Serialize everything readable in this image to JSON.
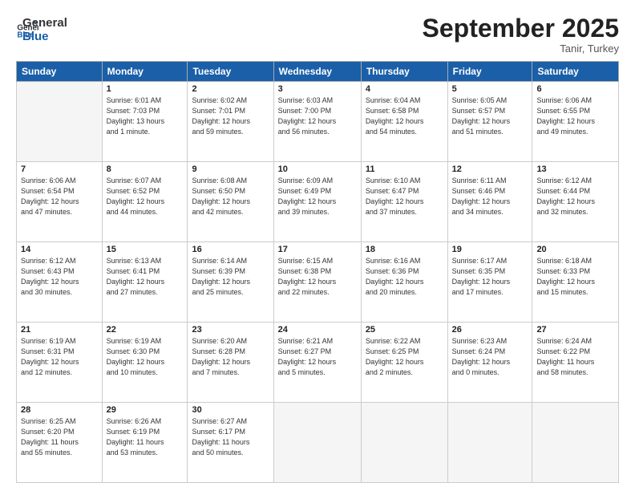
{
  "logo": {
    "line1": "General",
    "line2": "Blue"
  },
  "title": "September 2025",
  "location": "Tanir, Turkey",
  "days_header": [
    "Sunday",
    "Monday",
    "Tuesday",
    "Wednesday",
    "Thursday",
    "Friday",
    "Saturday"
  ],
  "weeks": [
    [
      {
        "day": "",
        "detail": ""
      },
      {
        "day": "1",
        "detail": "Sunrise: 6:01 AM\nSunset: 7:03 PM\nDaylight: 13 hours\nand 1 minute."
      },
      {
        "day": "2",
        "detail": "Sunrise: 6:02 AM\nSunset: 7:01 PM\nDaylight: 12 hours\nand 59 minutes."
      },
      {
        "day": "3",
        "detail": "Sunrise: 6:03 AM\nSunset: 7:00 PM\nDaylight: 12 hours\nand 56 minutes."
      },
      {
        "day": "4",
        "detail": "Sunrise: 6:04 AM\nSunset: 6:58 PM\nDaylight: 12 hours\nand 54 minutes."
      },
      {
        "day": "5",
        "detail": "Sunrise: 6:05 AM\nSunset: 6:57 PM\nDaylight: 12 hours\nand 51 minutes."
      },
      {
        "day": "6",
        "detail": "Sunrise: 6:06 AM\nSunset: 6:55 PM\nDaylight: 12 hours\nand 49 minutes."
      }
    ],
    [
      {
        "day": "7",
        "detail": "Sunrise: 6:06 AM\nSunset: 6:54 PM\nDaylight: 12 hours\nand 47 minutes."
      },
      {
        "day": "8",
        "detail": "Sunrise: 6:07 AM\nSunset: 6:52 PM\nDaylight: 12 hours\nand 44 minutes."
      },
      {
        "day": "9",
        "detail": "Sunrise: 6:08 AM\nSunset: 6:50 PM\nDaylight: 12 hours\nand 42 minutes."
      },
      {
        "day": "10",
        "detail": "Sunrise: 6:09 AM\nSunset: 6:49 PM\nDaylight: 12 hours\nand 39 minutes."
      },
      {
        "day": "11",
        "detail": "Sunrise: 6:10 AM\nSunset: 6:47 PM\nDaylight: 12 hours\nand 37 minutes."
      },
      {
        "day": "12",
        "detail": "Sunrise: 6:11 AM\nSunset: 6:46 PM\nDaylight: 12 hours\nand 34 minutes."
      },
      {
        "day": "13",
        "detail": "Sunrise: 6:12 AM\nSunset: 6:44 PM\nDaylight: 12 hours\nand 32 minutes."
      }
    ],
    [
      {
        "day": "14",
        "detail": "Sunrise: 6:12 AM\nSunset: 6:43 PM\nDaylight: 12 hours\nand 30 minutes."
      },
      {
        "day": "15",
        "detail": "Sunrise: 6:13 AM\nSunset: 6:41 PM\nDaylight: 12 hours\nand 27 minutes."
      },
      {
        "day": "16",
        "detail": "Sunrise: 6:14 AM\nSunset: 6:39 PM\nDaylight: 12 hours\nand 25 minutes."
      },
      {
        "day": "17",
        "detail": "Sunrise: 6:15 AM\nSunset: 6:38 PM\nDaylight: 12 hours\nand 22 minutes."
      },
      {
        "day": "18",
        "detail": "Sunrise: 6:16 AM\nSunset: 6:36 PM\nDaylight: 12 hours\nand 20 minutes."
      },
      {
        "day": "19",
        "detail": "Sunrise: 6:17 AM\nSunset: 6:35 PM\nDaylight: 12 hours\nand 17 minutes."
      },
      {
        "day": "20",
        "detail": "Sunrise: 6:18 AM\nSunset: 6:33 PM\nDaylight: 12 hours\nand 15 minutes."
      }
    ],
    [
      {
        "day": "21",
        "detail": "Sunrise: 6:19 AM\nSunset: 6:31 PM\nDaylight: 12 hours\nand 12 minutes."
      },
      {
        "day": "22",
        "detail": "Sunrise: 6:19 AM\nSunset: 6:30 PM\nDaylight: 12 hours\nand 10 minutes."
      },
      {
        "day": "23",
        "detail": "Sunrise: 6:20 AM\nSunset: 6:28 PM\nDaylight: 12 hours\nand 7 minutes."
      },
      {
        "day": "24",
        "detail": "Sunrise: 6:21 AM\nSunset: 6:27 PM\nDaylight: 12 hours\nand 5 minutes."
      },
      {
        "day": "25",
        "detail": "Sunrise: 6:22 AM\nSunset: 6:25 PM\nDaylight: 12 hours\nand 2 minutes."
      },
      {
        "day": "26",
        "detail": "Sunrise: 6:23 AM\nSunset: 6:24 PM\nDaylight: 12 hours\nand 0 minutes."
      },
      {
        "day": "27",
        "detail": "Sunrise: 6:24 AM\nSunset: 6:22 PM\nDaylight: 11 hours\nand 58 minutes."
      }
    ],
    [
      {
        "day": "28",
        "detail": "Sunrise: 6:25 AM\nSunset: 6:20 PM\nDaylight: 11 hours\nand 55 minutes."
      },
      {
        "day": "29",
        "detail": "Sunrise: 6:26 AM\nSunset: 6:19 PM\nDaylight: 11 hours\nand 53 minutes."
      },
      {
        "day": "30",
        "detail": "Sunrise: 6:27 AM\nSunset: 6:17 PM\nDaylight: 11 hours\nand 50 minutes."
      },
      {
        "day": "",
        "detail": ""
      },
      {
        "day": "",
        "detail": ""
      },
      {
        "day": "",
        "detail": ""
      },
      {
        "day": "",
        "detail": ""
      }
    ]
  ]
}
